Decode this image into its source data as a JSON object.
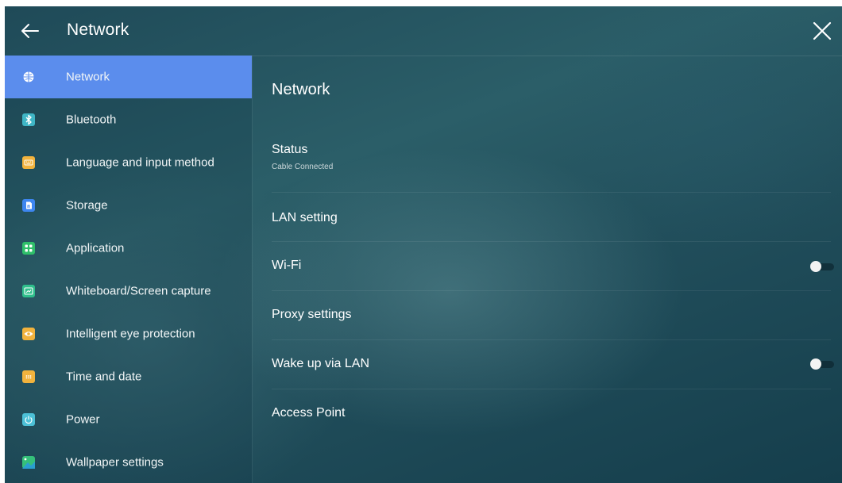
{
  "header": {
    "title": "Network",
    "back_icon": "arrow-left-icon",
    "close_icon": "close-icon"
  },
  "sidebar": {
    "active_color": "#5b8ded",
    "items": [
      {
        "label": "Network",
        "icon": "globe-icon",
        "color": "#5b8ded",
        "active": true
      },
      {
        "label": "Bluetooth",
        "icon": "bluetooth-icon",
        "color": "#3fb6c6"
      },
      {
        "label": "Language and input method",
        "icon": "keyboard-icon",
        "color": "#f2b33d"
      },
      {
        "label": "Storage",
        "icon": "storage-icon",
        "color": "#3d86f0"
      },
      {
        "label": "Application",
        "icon": "apps-grid-icon",
        "color": "#2fbf6a"
      },
      {
        "label": "Whiteboard/Screen capture",
        "icon": "screen-capture-icon",
        "color": "#2fbf8c"
      },
      {
        "label": "Intelligent eye protection",
        "icon": "eye-icon",
        "color": "#f2b33d"
      },
      {
        "label": "Time and date",
        "icon": "calendar-icon",
        "color": "#f2b33d"
      },
      {
        "label": "Power",
        "icon": "power-icon",
        "color": "#4cc0d6"
      },
      {
        "label": "Wallpaper settings",
        "icon": "image-icon",
        "color": "#35c07a"
      }
    ]
  },
  "main": {
    "title": "Network",
    "rows": {
      "status": {
        "label": "Status",
        "sub": "Cable Connected"
      },
      "lan": {
        "label": "LAN setting"
      },
      "wifi": {
        "label": "Wi-Fi",
        "toggle_on": false
      },
      "proxy": {
        "label": "Proxy settings"
      },
      "wake": {
        "label": "Wake up via LAN",
        "toggle_on": false
      },
      "ap": {
        "label": "Access Point"
      }
    }
  }
}
